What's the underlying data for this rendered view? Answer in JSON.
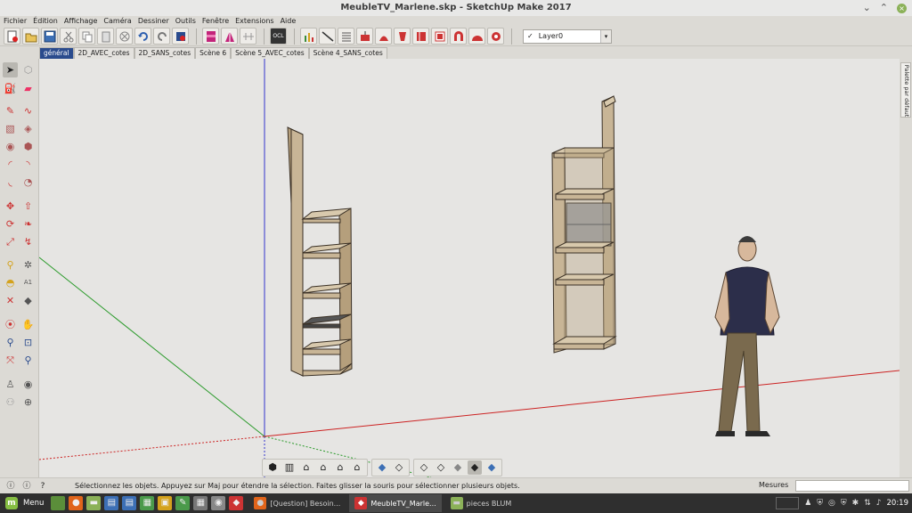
{
  "window": {
    "title": "MeubleTV_Marlene.skp - SketchUp Make 2017",
    "controls": {
      "minimize": "⌄",
      "maximize": "⌃",
      "close": "×"
    }
  },
  "menubar": [
    "Fichier",
    "Édition",
    "Affichage",
    "Caméra",
    "Dessiner",
    "Outils",
    "Fenêtre",
    "Extensions",
    "Aide"
  ],
  "toolbar": {
    "layer_selected": "Layer0",
    "layer_check": "✓"
  },
  "scene_tabs": [
    "général",
    "2D_AVEC_cotes",
    "2D_SANS_cotes",
    "Scène 6",
    "Scène 5_AVEC_cotes",
    "Scène 4_SANS_cotes"
  ],
  "active_scene_tab": 0,
  "right_tray": {
    "label": "Palette par défaut"
  },
  "statusbar": {
    "message": "Sélectionnez les objets. Appuyez sur Maj pour étendre la sélection. Faites glisser la souris pour sélectionner plusieurs objets.",
    "measurements_label": "Mesures",
    "measurements_value": ""
  },
  "taskbar": {
    "menu_label": "Menu",
    "tasks": [
      {
        "label": "[Question] Besoin...",
        "active": false,
        "icon": "firefox-icon"
      },
      {
        "label": "MeubleTV_Marle...",
        "active": true,
        "icon": "sketchup-icon"
      },
      {
        "label": "pieces BLUM",
        "active": false,
        "icon": "folder-icon"
      }
    ],
    "clock": "20:19"
  },
  "colors": {
    "viewport_bg": "#e6e5e3",
    "red_axis": "#cc2222",
    "green_axis": "#2a9a2a",
    "blue_axis": "#3333cc",
    "wood": "#c8b596",
    "active_tab": "#2a4b8d"
  }
}
